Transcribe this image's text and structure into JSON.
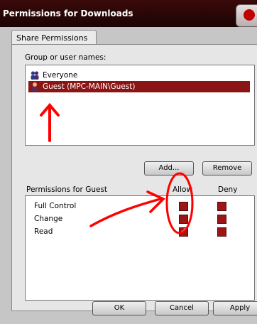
{
  "window": {
    "title": "Permissions for Downloads"
  },
  "tabs": [
    {
      "label": "Share Permissions"
    }
  ],
  "group_label": "Group or user names:",
  "users": [
    {
      "name": "Everyone",
      "icon": "group-icon",
      "selected": false
    },
    {
      "name": "Guest (MPC-MAIN\\Guest)",
      "icon": "user-icon",
      "selected": true
    }
  ],
  "buttons": {
    "add": "Add...",
    "remove": "Remove",
    "ok": "OK",
    "cancel": "Cancel",
    "apply": "Apply"
  },
  "permissions": {
    "label": "Permissions for Guest",
    "allow_label": "Allow",
    "deny_label": "Deny",
    "rows": [
      {
        "name": "Full Control",
        "allow": false,
        "deny": false
      },
      {
        "name": "Change",
        "allow": false,
        "deny": false
      },
      {
        "name": "Read",
        "allow": true,
        "deny": false
      }
    ]
  },
  "colors": {
    "accent": "#8b1414",
    "annotation": "#ff0000"
  }
}
